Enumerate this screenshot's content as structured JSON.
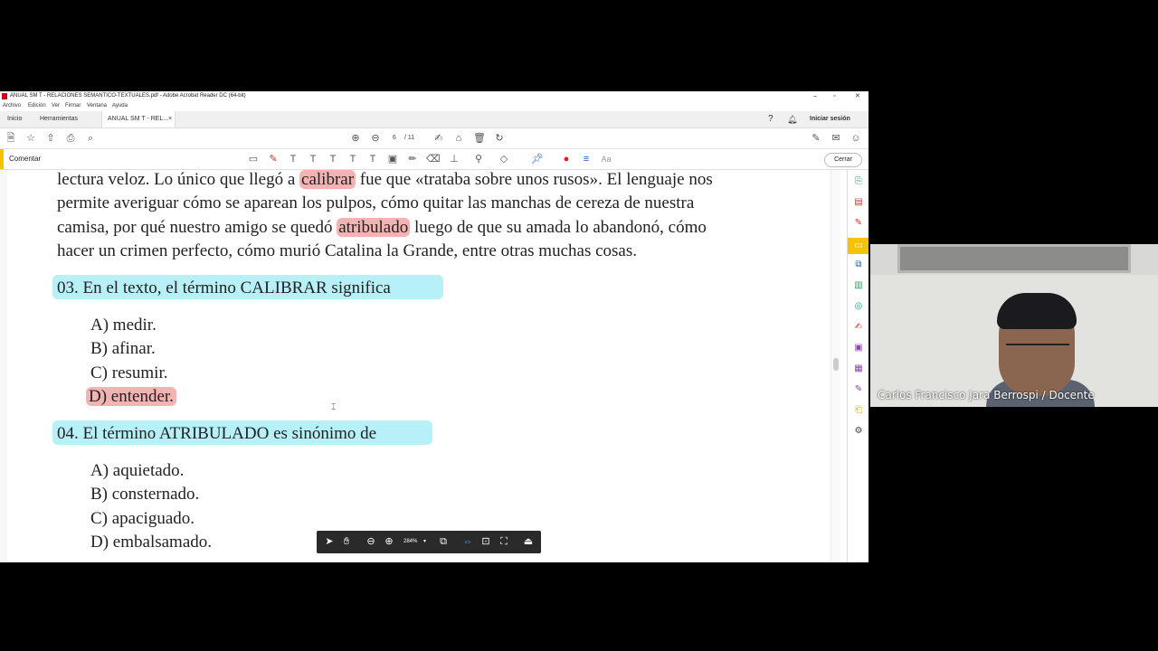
{
  "window": {
    "title": "ANUAL SM T - RELACIONES SEMANTICO-TEXTUALES.pdf - Adobe Acrobat Reader DC (64-bit)",
    "menu": [
      "Archivo",
      "Edición",
      "Ver",
      "Firmar",
      "Ventana",
      "Ayuda"
    ],
    "tabs": {
      "home": "Inicio",
      "tools": "Herramientas",
      "doc": "ANUAL SM T - REL..."
    },
    "signin": "Iniciar sesión",
    "page_current": "6",
    "page_total": "/ 11",
    "comment_label": "Comentar",
    "close_label": "Cerrar",
    "zoom": "284%"
  },
  "document": {
    "para_lines": [
      "lectura veloz. Lo único que llegó a ",
      "permite averiguar cómo se aparean los pulpos, cómo quitar las manchas de cereza de nuestra",
      "camisa, por qué nuestro amigo se quedó ",
      "hacer un crimen perfecto, cómo murió Catalina la Grande, entre otras muchas cosas."
    ],
    "highlight_1": "calibrar",
    "after_1": " fue que «trataba sobre unos rusos». El lenguaje nos",
    "highlight_2": "atribulado",
    "after_2": " luego de que su amada lo abandonó, cómo",
    "q3": "03.  En el texto, el término CALIBRAR significa",
    "q3_options": [
      "A) medir.",
      "B) afinar.",
      "C) resumir.",
      "D) entender."
    ],
    "q4": "04.  El término ATRIBULADO es sinónimo de",
    "q4_options": [
      "A) aquietado.",
      "B) consternado.",
      "C) apaciguado.",
      "D) embalsamado."
    ]
  },
  "webcam": {
    "name": "Carlos Francisco Jara Berrospi / Docente"
  },
  "colors": {
    "highlight_red": "#f4b3b3",
    "highlight_cyan": "#b7f0f7",
    "comment_accent": "#f5c400"
  }
}
